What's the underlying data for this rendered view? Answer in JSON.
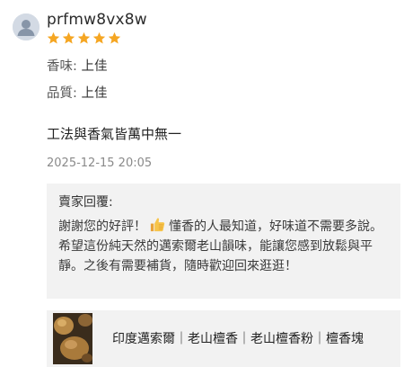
{
  "review": {
    "username": "prfmw8vx8w",
    "rating": 5,
    "star_color": "#f5a623",
    "avatar_icon": "user-icon",
    "attributes": [
      {
        "key": "香味:",
        "value": "上佳"
      },
      {
        "key": "品質:",
        "value": "上佳"
      }
    ],
    "comment": "工法與香氣皆萬中無一",
    "timestamp": "2025-12-15 20:05"
  },
  "seller_reply": {
    "title": "賣家回覆:",
    "text_before_emoji": "謝謝您的好評！",
    "emoji": "thumbs-up-icon",
    "text_after_emoji": "懂香的人最知道，好味道不需要多說。希望這份純天然的邁索爾老山韻味，能讓您感到放鬆與平靜。之後有需要補貨，隨時歡迎回來逛逛！"
  },
  "product": {
    "title": "印度邁索爾｜老山檀香｜老山檀香粉｜檀香塊",
    "image_icon": "sandalwood-product-thumbnail"
  }
}
